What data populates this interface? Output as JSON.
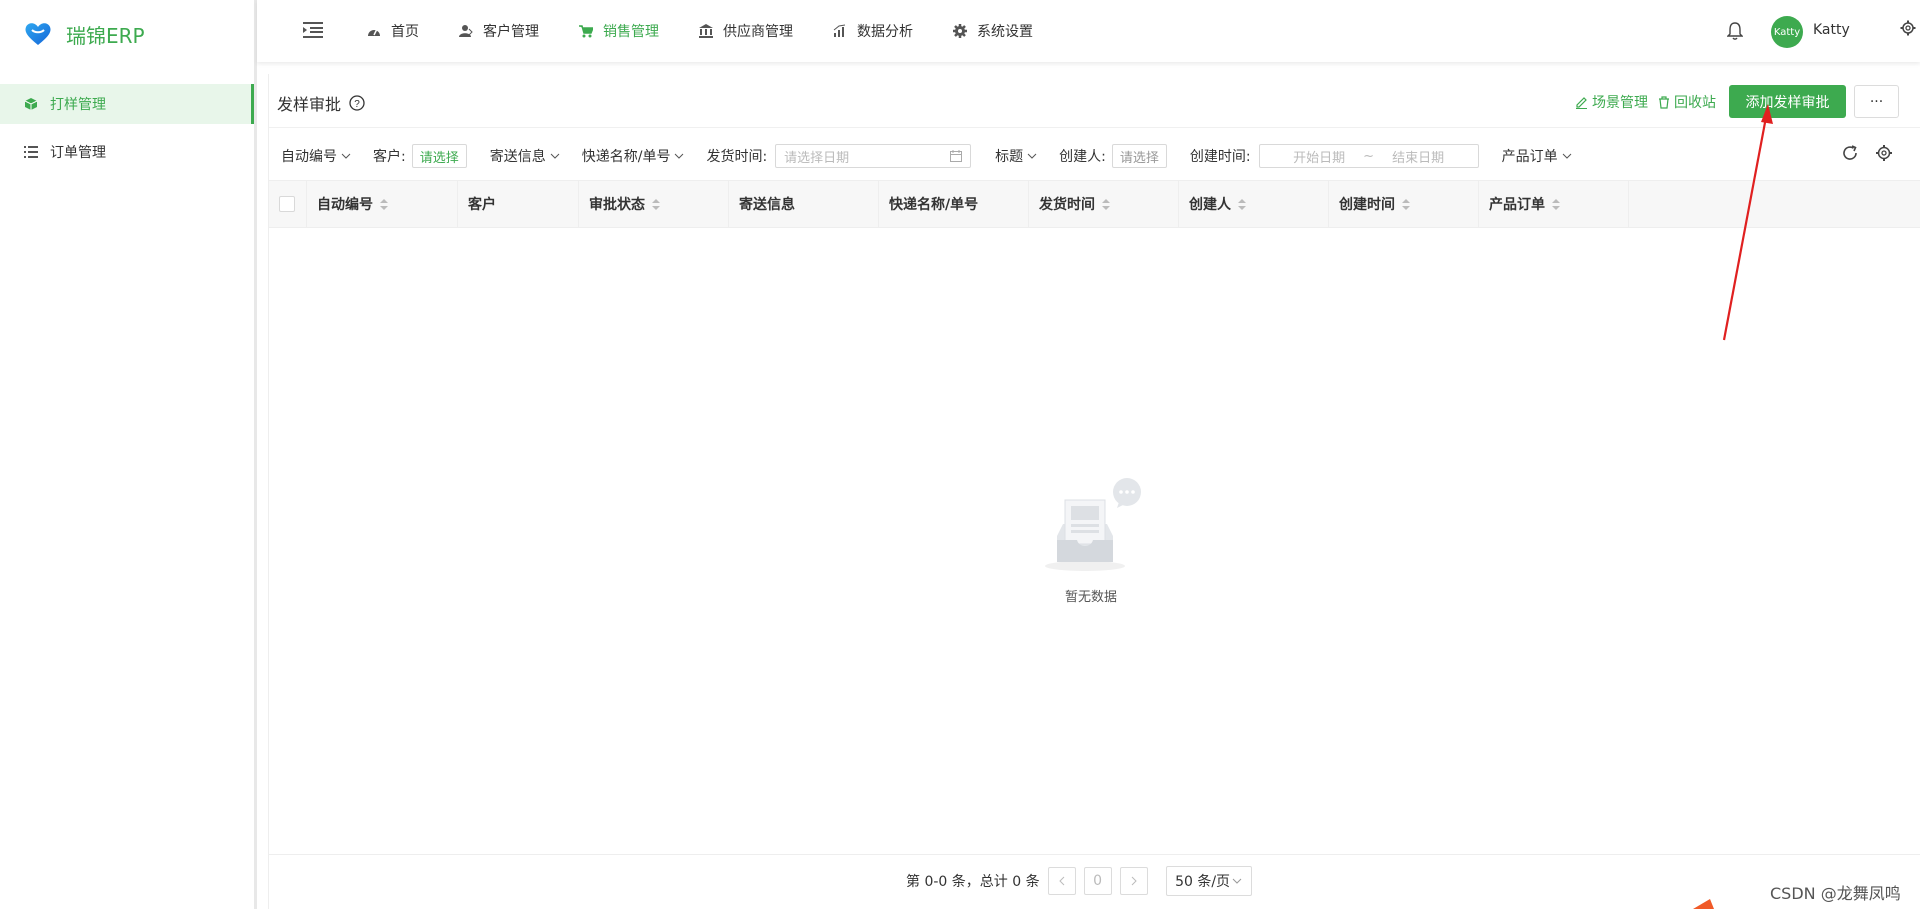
{
  "app": {
    "name": "瑞锦ERP"
  },
  "sidebar": {
    "items": [
      {
        "label": "打样管理"
      },
      {
        "label": "订单管理"
      }
    ]
  },
  "topnav": {
    "items": [
      {
        "label": "首页"
      },
      {
        "label": "客户管理"
      },
      {
        "label": "销售管理"
      },
      {
        "label": "供应商管理"
      },
      {
        "label": "数据分析"
      },
      {
        "label": "系统设置"
      }
    ],
    "active": "销售管理",
    "user": {
      "avatar_text": "Katty",
      "name": "Katty"
    }
  },
  "page": {
    "title": "发样审批",
    "links": {
      "scene": "场景管理",
      "trash": "回收站"
    },
    "add_button": "添加发样审批",
    "more_button": "···"
  },
  "filters": {
    "auto_no": "自动编号",
    "customer_label": "客户:",
    "customer_value": "请选择",
    "send_info": "寄送信息",
    "express": "快递名称/单号",
    "ship_time_label": "发货时间:",
    "ship_time_placeholder": "请选择日期",
    "title": "标题",
    "creator_label": "创建人:",
    "creator_value": "请选择",
    "create_time_label": "创建时间:",
    "start_date": "开始日期",
    "range_sep": "~",
    "end_date": "结束日期",
    "product_order": "产品订单"
  },
  "table": {
    "columns": [
      "自动编号",
      "客户",
      "审批状态",
      "寄送信息",
      "快递名称/单号",
      "发货时间",
      "创建人",
      "创建时间",
      "产品订单"
    ],
    "empty_text": "暂无数据"
  },
  "pagination": {
    "summary": "第 0-0 条，总计 0 条",
    "current_page": "0",
    "page_size": "50 条/页"
  },
  "watermark": "CSDN @龙舞凤鸣",
  "colors": {
    "accent": "#3daa4f",
    "annotation": "#e02020"
  }
}
